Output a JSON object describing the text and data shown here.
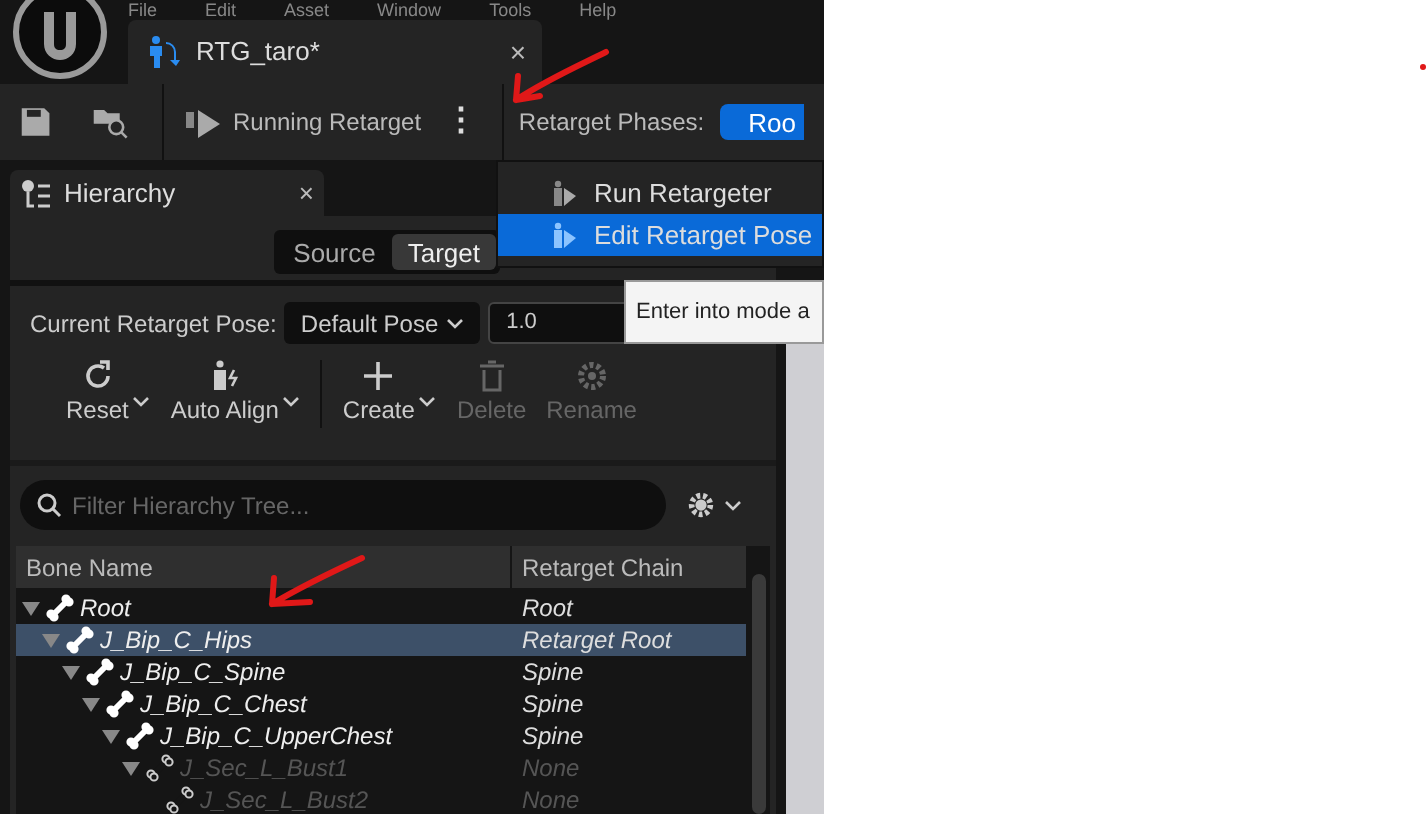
{
  "menu_bar": [
    "File",
    "Edit",
    "Asset",
    "Window",
    "Tools",
    "Help"
  ],
  "tab": {
    "title": "RTG_taro*",
    "close": "×"
  },
  "toolbar": {
    "run_button": "Running Retarget",
    "more": "⋮",
    "phases_label": "Retarget Phases:",
    "phase_button": "Roo"
  },
  "dropdown_menu": [
    {
      "label": "Run Retargeter",
      "selected": false
    },
    {
      "label": "Edit Retarget Pose",
      "selected": true
    }
  ],
  "tooltip": "Enter into mode a",
  "panel": {
    "title": "Hierarchy",
    "close": "×",
    "toggle": [
      {
        "label": "Source",
        "selected": false
      },
      {
        "label": "Target",
        "selected": true
      }
    ],
    "pose_label": "Current Retarget Pose:",
    "pose_value": "Default Pose",
    "blend_value": "1.0",
    "actions": [
      {
        "label": "Reset",
        "disabled": false,
        "dropdown": true
      },
      {
        "label": "Auto Align",
        "disabled": false,
        "dropdown": true
      },
      {
        "label": "Create",
        "disabled": false,
        "dropdown": true
      },
      {
        "label": "Delete",
        "disabled": true,
        "dropdown": false
      },
      {
        "label": "Rename",
        "disabled": true,
        "dropdown": false
      }
    ],
    "search": {
      "placeholder": "Filter Hierarchy Tree..."
    },
    "columns": [
      "Bone Name",
      "Retarget Chain"
    ],
    "tree": [
      {
        "name": "Root",
        "chain": "Root",
        "selected": false,
        "disabled": false,
        "expanded": true,
        "children": [
          {
            "name": "J_Bip_C_Hips",
            "chain": "Retarget Root",
            "selected": true,
            "disabled": false,
            "expanded": true,
            "children": [
              {
                "name": "J_Bip_C_Spine",
                "chain": "Spine",
                "selected": false,
                "disabled": false,
                "expanded": true,
                "children": [
                  {
                    "name": "J_Bip_C_Chest",
                    "chain": "Spine",
                    "selected": false,
                    "disabled": false,
                    "expanded": true,
                    "children": [
                      {
                        "name": "J_Bip_C_UpperChest",
                        "chain": "Spine",
                        "selected": false,
                        "disabled": false,
                        "expanded": true,
                        "children": [
                          {
                            "name": "J_Sec_L_Bust1",
                            "chain": "None",
                            "selected": false,
                            "disabled": true,
                            "expanded": true,
                            "children": [
                              {
                                "name": "J_Sec_L_Bust2",
                                "chain": "None",
                                "selected": false,
                                "disabled": true
                              }
                            ]
                          }
                        ]
                      }
                    ]
                  }
                ]
              }
            ]
          }
        ]
      }
    ]
  }
}
